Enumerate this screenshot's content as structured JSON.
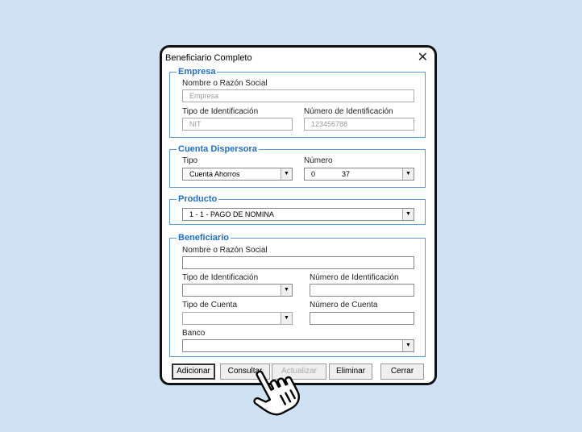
{
  "window": {
    "title": "Beneficiario Completo",
    "close_glyph": "✕"
  },
  "empresa": {
    "legend": "Empresa",
    "nombre_label": "Nombre o Razón Social",
    "nombre_value": "Empresa",
    "tipo_label": "Tipo de Identificación",
    "tipo_value": "NIT",
    "numero_label": "Número  de Identificación",
    "numero_value": "123456788"
  },
  "cuenta_dispersora": {
    "legend": "Cuenta Dispersora",
    "tipo_label": "Tipo",
    "tipo_value": "Cuenta Ahorros",
    "numero_label": "Número",
    "numero_value_a": "0",
    "numero_value_b": "37"
  },
  "producto": {
    "legend": "Producto",
    "value": "1 - 1 - PAGO DE NOMINA"
  },
  "beneficiario": {
    "legend": "Beneficiario",
    "nombre_label": "Nombre o Razón Social",
    "nombre_value": "",
    "tipo_id_label": "Tipo de Identificación",
    "tipo_id_value": "",
    "numero_id_label": "Número de Identificación",
    "numero_id_value": "",
    "tipo_cuenta_label": "Tipo de Cuenta",
    "tipo_cuenta_value": "",
    "numero_cuenta_label": "Número de Cuenta",
    "numero_cuenta_value": "",
    "banco_label": "Banco",
    "banco_value": ""
  },
  "buttons": {
    "adicionar": "Adicionar",
    "consultar": "Consultar",
    "actualizar": "Actualizar",
    "eliminar": "Eliminar",
    "cerrar": "Cerrar"
  },
  "icons": {
    "dropdown_arrow": "▼",
    "pointer": "hand-pointer-icon"
  }
}
